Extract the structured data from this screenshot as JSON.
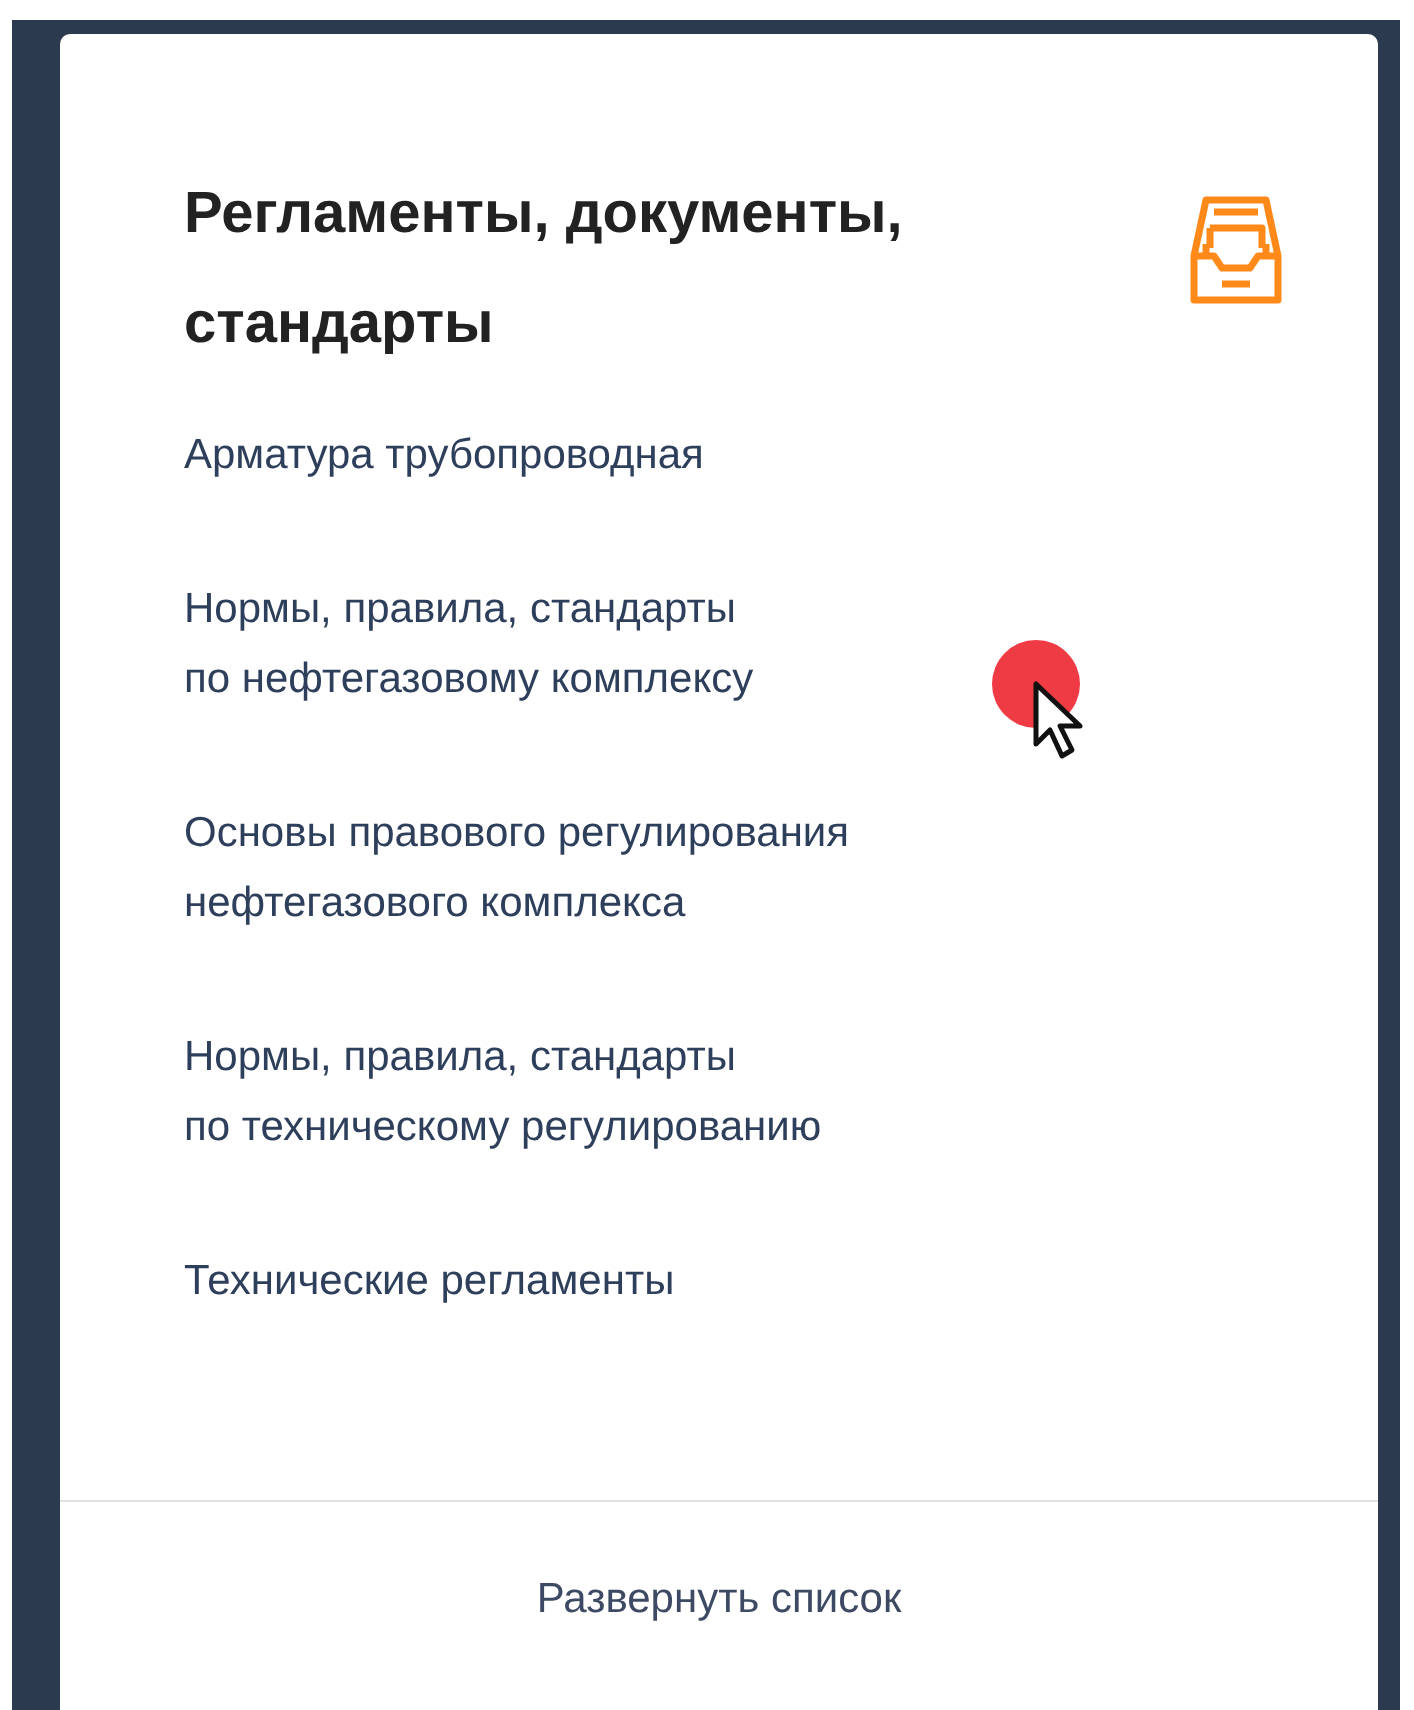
{
  "card": {
    "title": "Регламенты, документы, стандарты",
    "links": [
      {
        "lines": [
          "Арматура трубопроводная"
        ]
      },
      {
        "lines": [
          "Нормы, правила, стандарты",
          "по нефтегазовому комплексу"
        ]
      },
      {
        "lines": [
          "Основы правового регулирования",
          "нефтегазового комплекса"
        ]
      },
      {
        "lines": [
          "Нормы, правила, стандарты",
          "по техническому регулированию"
        ]
      },
      {
        "lines": [
          "Технические регламенты"
        ]
      }
    ],
    "expand_button": "Развернуть список"
  }
}
